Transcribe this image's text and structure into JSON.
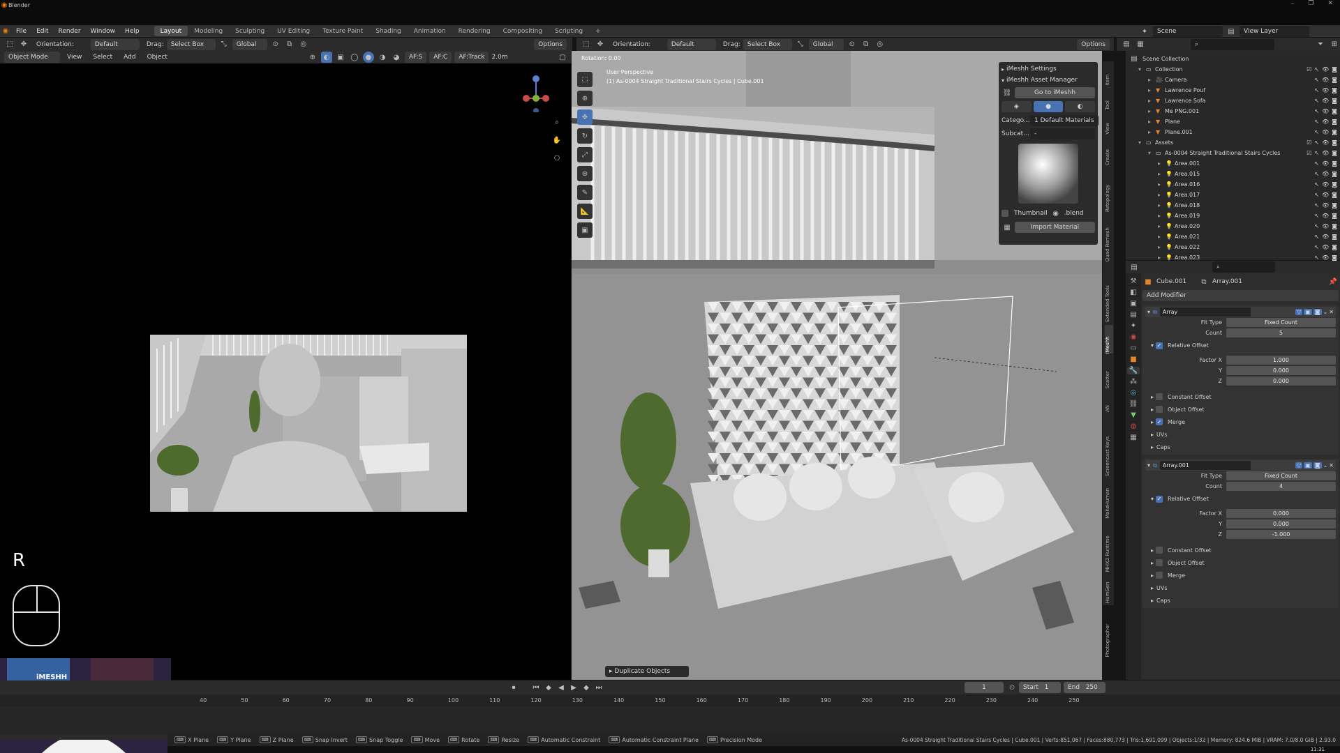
{
  "window": {
    "title": "Blender"
  },
  "menu": [
    "File",
    "Edit",
    "Render",
    "Window",
    "Help"
  ],
  "workspaces": [
    "Layout",
    "Modeling",
    "Sculpting",
    "UV Editing",
    "Texture Paint",
    "Shading",
    "Animation",
    "Rendering",
    "Compositing",
    "Scripting",
    "+"
  ],
  "active_workspace": "Layout",
  "header_right": {
    "scene_label": "Scene",
    "view_layer_label": "View Layer"
  },
  "toolbar_left": {
    "orientation_label": "Orientation:",
    "orientation_value": "Default",
    "drag_label": "Drag:",
    "drag_value": "Select Box",
    "transform_value": "Global",
    "options": "Options"
  },
  "toolbar_right": {
    "orientation_label": "Orientation:",
    "orientation_value": "Default",
    "drag_label": "Drag:",
    "drag_value": "Select Box",
    "transform_value": "Global",
    "options": "Options"
  },
  "view_header": {
    "mode": "Object Mode",
    "view": "View",
    "select": "Select",
    "add": "Add",
    "object": "Object",
    "af_s": "AF:S",
    "af_c": "AF:C",
    "af_track": "AF:Track",
    "distance": "2.0m"
  },
  "viewport": {
    "rotation_label": "Rotation: 0.00",
    "perspective": "User Perspective",
    "scene_info": "(1) As-0004 Straight Traditional Stairs Cycles | Cube.001",
    "redo_panel": "Duplicate Objects",
    "key_overlay": "R"
  },
  "imeshh": {
    "settings": "iMeshh Settings",
    "asset_manager": "iMeshh Asset Manager",
    "goto": "Go to iMeshh",
    "category_label": "Catego...",
    "category_value": "1 Default Materials",
    "subcategory_label": "Subcat...",
    "subcategory_value": "-",
    "thumbnail": "Thumbnail",
    "blend": ".blend",
    "import": "Import Material"
  },
  "sidebar_tabs": [
    "Item",
    "Tool",
    "View",
    "Create",
    "Retopology",
    "Quad Remesh",
    "Extended Tools",
    "iMeshh",
    "Scatter",
    "AN",
    "Screencast Keys",
    "MakeHuman",
    "MHX2 Runtime",
    "HumGen",
    "Photographer"
  ],
  "outliner": {
    "scene_collection": "Scene Collection",
    "items": [
      {
        "label": "Collection",
        "depth": 1,
        "kind": "collection"
      },
      {
        "label": "Camera",
        "depth": 2,
        "kind": "camera"
      },
      {
        "label": "Lawrence Pouf",
        "depth": 2,
        "kind": "mesh"
      },
      {
        "label": "Lawrence Sofa",
        "depth": 2,
        "kind": "mesh"
      },
      {
        "label": "Me PNG.001",
        "depth": 2,
        "kind": "mesh"
      },
      {
        "label": "Plane",
        "depth": 2,
        "kind": "mesh"
      },
      {
        "label": "Plane.001",
        "depth": 2,
        "kind": "mesh"
      },
      {
        "label": "Assets",
        "depth": 1,
        "kind": "collection"
      },
      {
        "label": "As-0004 Straight Traditional Stairs Cycles",
        "depth": 2,
        "kind": "collection"
      },
      {
        "label": "Area.001",
        "depth": 3,
        "kind": "light"
      },
      {
        "label": "Area.015",
        "depth": 3,
        "kind": "light"
      },
      {
        "label": "Area.016",
        "depth": 3,
        "kind": "light"
      },
      {
        "label": "Area.017",
        "depth": 3,
        "kind": "light"
      },
      {
        "label": "Area.018",
        "depth": 3,
        "kind": "light"
      },
      {
        "label": "Area.019",
        "depth": 3,
        "kind": "light"
      },
      {
        "label": "Area.020",
        "depth": 3,
        "kind": "light"
      },
      {
        "label": "Area.021",
        "depth": 3,
        "kind": "light"
      },
      {
        "label": "Area.022",
        "depth": 3,
        "kind": "light"
      },
      {
        "label": "Area.023",
        "depth": 3,
        "kind": "light"
      }
    ]
  },
  "properties": {
    "object_name": "Cube.001",
    "modifier_name": "Array.001",
    "add_modifier": "Add Modifier",
    "modifiers": [
      {
        "name": "Array",
        "fit_type_label": "Fit Type",
        "fit_type": "Fixed Count",
        "count_label": "Count",
        "count": "5",
        "relative_offset": "Relative Offset",
        "factor_x_label": "Factor X",
        "factor_x": "1.000",
        "y_label": "Y",
        "factor_y": "0.000",
        "z_label": "Z",
        "factor_z": "0.000",
        "constant_offset": "Constant Offset",
        "object_offset": "Object Offset",
        "merge": "Merge",
        "merge_on": true,
        "uvs": "UVs",
        "caps": "Caps"
      },
      {
        "name": "Array.001",
        "fit_type_label": "Fit Type",
        "fit_type": "Fixed Count",
        "count_label": "Count",
        "count": "4",
        "relative_offset": "Relative Offset",
        "factor_x_label": "Factor X",
        "factor_x": "0.000",
        "y_label": "Y",
        "factor_y": "0.000",
        "z_label": "Z",
        "factor_z": "-1.000",
        "constant_offset": "Constant Offset",
        "object_offset": "Object Offset",
        "merge": "Merge",
        "merge_on": false,
        "uvs": "UVs",
        "caps": "Caps"
      }
    ]
  },
  "timeline": {
    "current_frame": "1",
    "start_label": "Start",
    "start": "1",
    "end_label": "End",
    "end": "250",
    "ticks": [
      "40",
      "50",
      "60",
      "70",
      "80",
      "90",
      "100",
      "110",
      "120",
      "130",
      "140",
      "150",
      "160",
      "170",
      "180",
      "190",
      "200",
      "210",
      "220",
      "230",
      "240",
      "250"
    ]
  },
  "statusbar": {
    "left": [
      "X Plane",
      "Y Plane",
      "Z Plane",
      "Snap Invert",
      "Snap Toggle",
      "Move",
      "Rotate",
      "Resize",
      "Automatic Constraint",
      "Automatic Constraint Plane",
      "Precision Mode"
    ],
    "right": "As-0004 Straight Traditional Stairs Cycles | Cube.001 | Verts:851,067 | Faces:880,773 | Tris:1,691,099 | Objects:1/32 | Memory: 824.6 MiB | VRAM: 7.0/8.0 GiB | 2.93.0"
  },
  "clock": "11:31",
  "webcam_logo": "iMESHH"
}
